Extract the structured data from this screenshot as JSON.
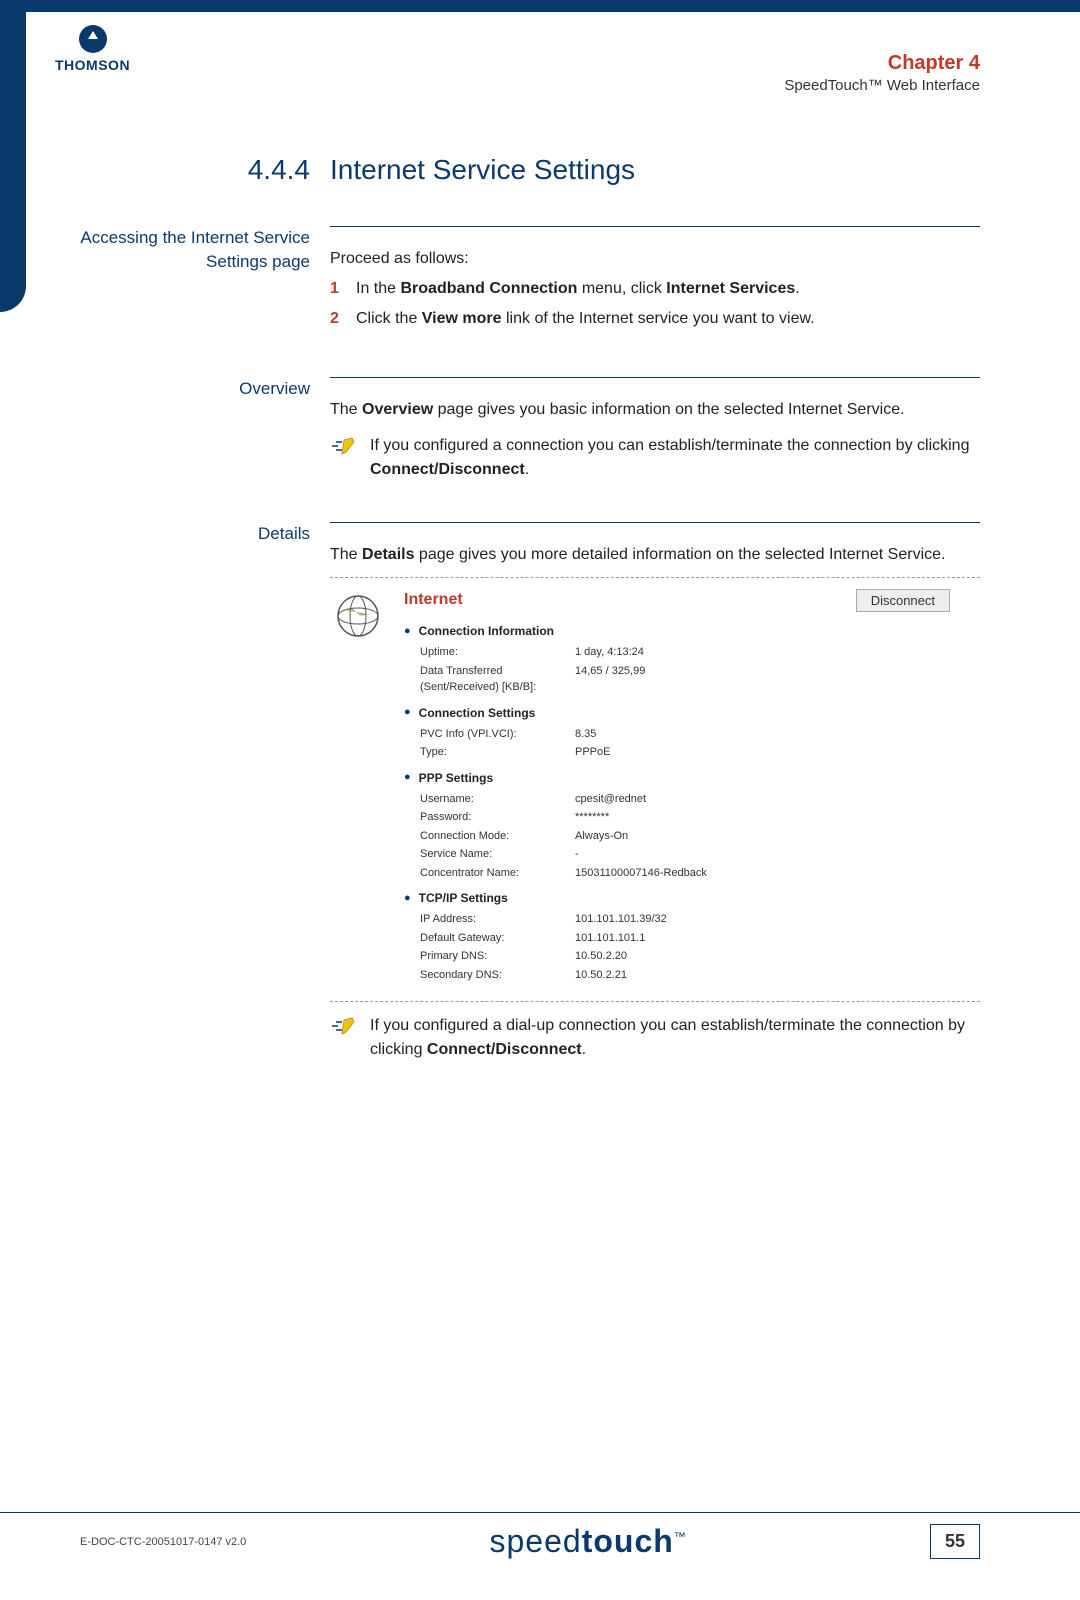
{
  "logo_text": "THOMSON",
  "chapter": "Chapter 4",
  "subtitle": "SpeedTouch™ Web Interface",
  "section_num": "4.4.4",
  "section_title": "Internet Service Settings",
  "block1": {
    "label": "Accessing the Internet Service Settings page",
    "intro": "Proceed as follows:",
    "steps": [
      {
        "n": "1",
        "pre": "In the ",
        "b1": "Broadband Connection",
        "mid": " menu, click ",
        "b2": "Internet Services",
        "post": "."
      },
      {
        "n": "2",
        "pre": "Click the ",
        "b1": "View more",
        "mid": " link of the Internet service you want to view.",
        "b2": "",
        "post": ""
      }
    ]
  },
  "block2": {
    "label": "Overview",
    "text_pre": "The ",
    "text_b": "Overview",
    "text_post": " page gives you basic information on the selected Internet Service.",
    "note_pre": "If you configured a connection you can establish/terminate the connection by clicking ",
    "note_b": "Connect/Disconnect",
    "note_post": "."
  },
  "block3": {
    "label": "Details",
    "text_pre": "The ",
    "text_b": "Details",
    "text_post": " page gives you more detailed information on the selected Internet Service.",
    "panel_title": "Internet",
    "disconnect": "Disconnect",
    "sections": [
      {
        "title": "Connection Information",
        "rows": [
          {
            "k": "Uptime:",
            "v": "1 day, 4:13:24"
          },
          {
            "k": "Data Transferred (Sent/Received) [KB/B]:",
            "v": "14,65 / 325,99"
          }
        ]
      },
      {
        "title": "Connection Settings",
        "rows": [
          {
            "k": "PVC Info (VPI.VCI):",
            "v": "8.35"
          },
          {
            "k": "Type:",
            "v": "PPPoE"
          }
        ]
      },
      {
        "title": "PPP Settings",
        "rows": [
          {
            "k": "Username:",
            "v": "cpesit@rednet"
          },
          {
            "k": "Password:",
            "v": "********"
          },
          {
            "k": "Connection Mode:",
            "v": "Always-On"
          },
          {
            "k": "Service Name:",
            "v": "-"
          },
          {
            "k": "Concentrator Name:",
            "v": "15031100007146-Redback"
          }
        ]
      },
      {
        "title": "TCP/IP Settings",
        "rows": [
          {
            "k": "IP Address:",
            "v": "101.101.101.39/32"
          },
          {
            "k": "Default Gateway:",
            "v": "101.101.101.1"
          },
          {
            "k": "Primary DNS:",
            "v": "10.50.2.20"
          },
          {
            "k": "Secondary DNS:",
            "v": "10.50.2.21"
          }
        ]
      }
    ],
    "note2_pre": "If you configured a dial-up connection you can establish/terminate the connection by clicking ",
    "note2_b": "Connect/Disconnect",
    "note2_post": "."
  },
  "footer": {
    "doc_id": "E-DOC-CTC-20051017-0147 v2.0",
    "logo_pre": "speed",
    "logo_b": "touch",
    "tm": "™",
    "page": "55"
  }
}
